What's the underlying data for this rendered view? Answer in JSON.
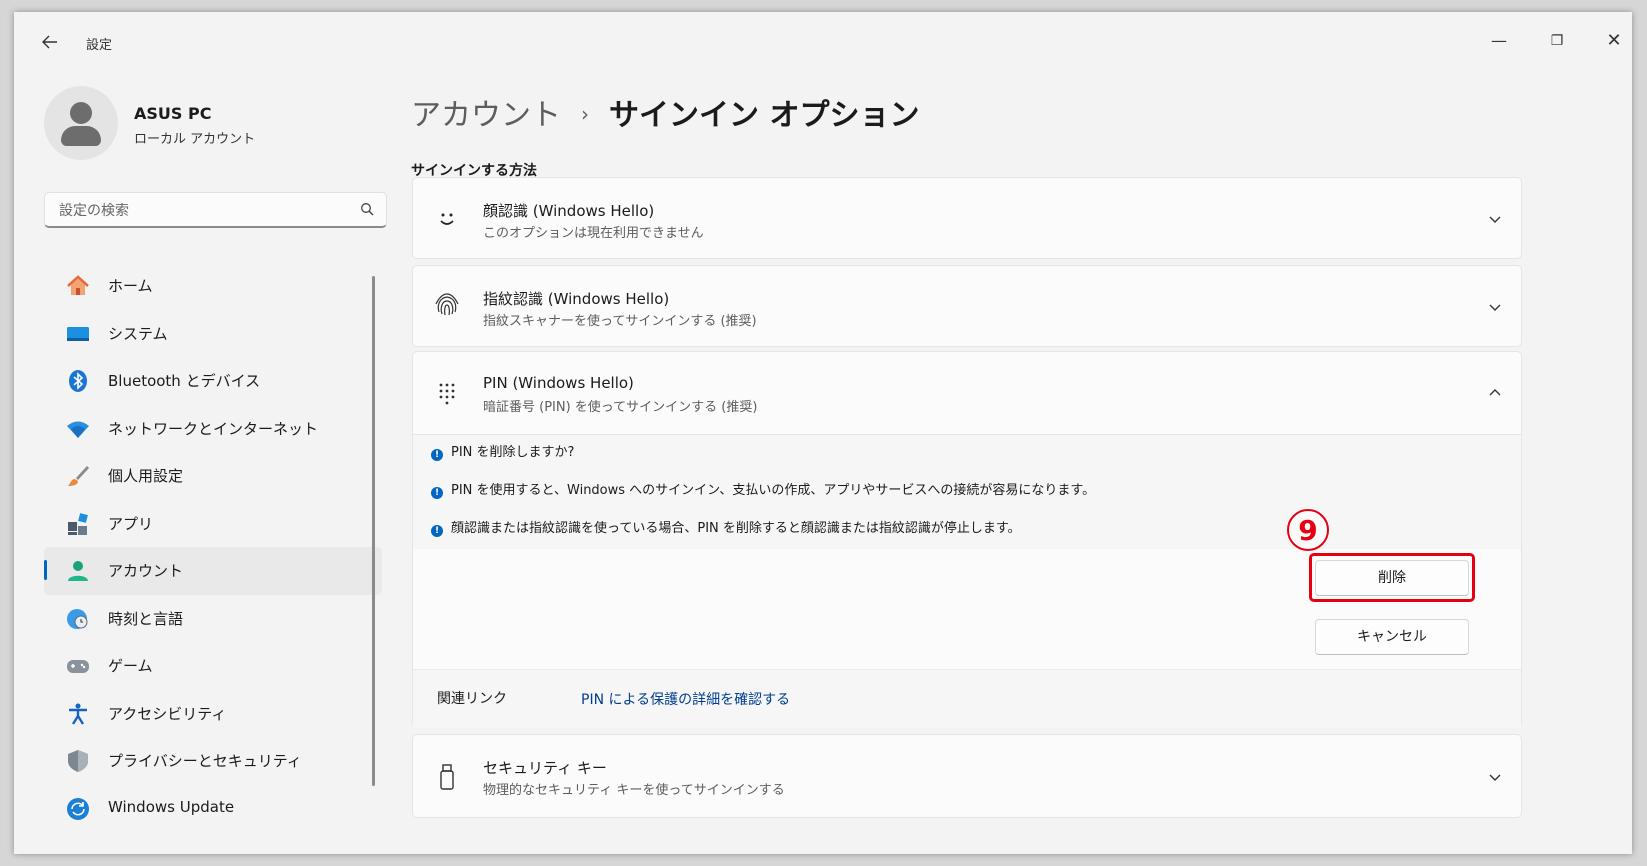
{
  "window": {
    "title": "設定",
    "controls": {
      "minimize": "—",
      "maximize": "❐",
      "close": "✕"
    }
  },
  "profile": {
    "name": "ASUS PC",
    "account_type": "ローカル アカウント"
  },
  "search": {
    "placeholder": "設定の検索"
  },
  "nav": {
    "items": [
      {
        "label": "ホーム",
        "icon": "home-icon"
      },
      {
        "label": "システム",
        "icon": "system-icon"
      },
      {
        "label": "Bluetooth とデバイス",
        "icon": "bluetooth-icon"
      },
      {
        "label": "ネットワークとインターネット",
        "icon": "wifi-icon"
      },
      {
        "label": "個人用設定",
        "icon": "brush-icon"
      },
      {
        "label": "アプリ",
        "icon": "apps-icon"
      },
      {
        "label": "アカウント",
        "icon": "account-icon",
        "active": true
      },
      {
        "label": "時刻と言語",
        "icon": "globe-clock-icon"
      },
      {
        "label": "ゲーム",
        "icon": "gamepad-icon"
      },
      {
        "label": "アクセシビリティ",
        "icon": "accessibility-icon"
      },
      {
        "label": "プライバシーとセキュリティ",
        "icon": "shield-icon"
      },
      {
        "label": "Windows Update",
        "icon": "update-icon"
      }
    ]
  },
  "breadcrumb": {
    "parent": "アカウント",
    "separator": "›",
    "current": "サインイン オプション"
  },
  "section_title": "サインインする方法",
  "options": {
    "face": {
      "title": "顔認識 (Windows Hello)",
      "subtitle": "このオプションは現在利用できません",
      "icon": "face-icon"
    },
    "fingerprint": {
      "title": "指紋認識 (Windows Hello)",
      "subtitle": "指紋スキャナーを使ってサインインする (推奨)",
      "icon": "fingerprint-icon"
    },
    "pin": {
      "title": "PIN (Windows Hello)",
      "subtitle": "暗証番号 (PIN) を使ってサインインする (推奨)",
      "icon": "keypad-icon",
      "info": [
        "PIN を削除しますか?",
        "PIN を使用すると、Windows へのサインイン、支払いの作成、アプリやサービスへの接続が容易になります。",
        "顔認識または指紋認識を使っている場合、PIN を削除すると顔認識または指紋認識が停止します。"
      ],
      "delete_label": "削除",
      "cancel_label": "キャンセル",
      "step_marker": "9",
      "related_label": "関連リンク",
      "related_link": "PIN による保護の詳細を確認する"
    },
    "security_key": {
      "title": "セキュリティ キー",
      "subtitle": "物理的なセキュリティ キーを使ってサインインする",
      "icon": "usb-key-icon"
    }
  },
  "colors": {
    "accent": "#0067c0",
    "highlight": "#e60012",
    "link": "#003e92"
  }
}
